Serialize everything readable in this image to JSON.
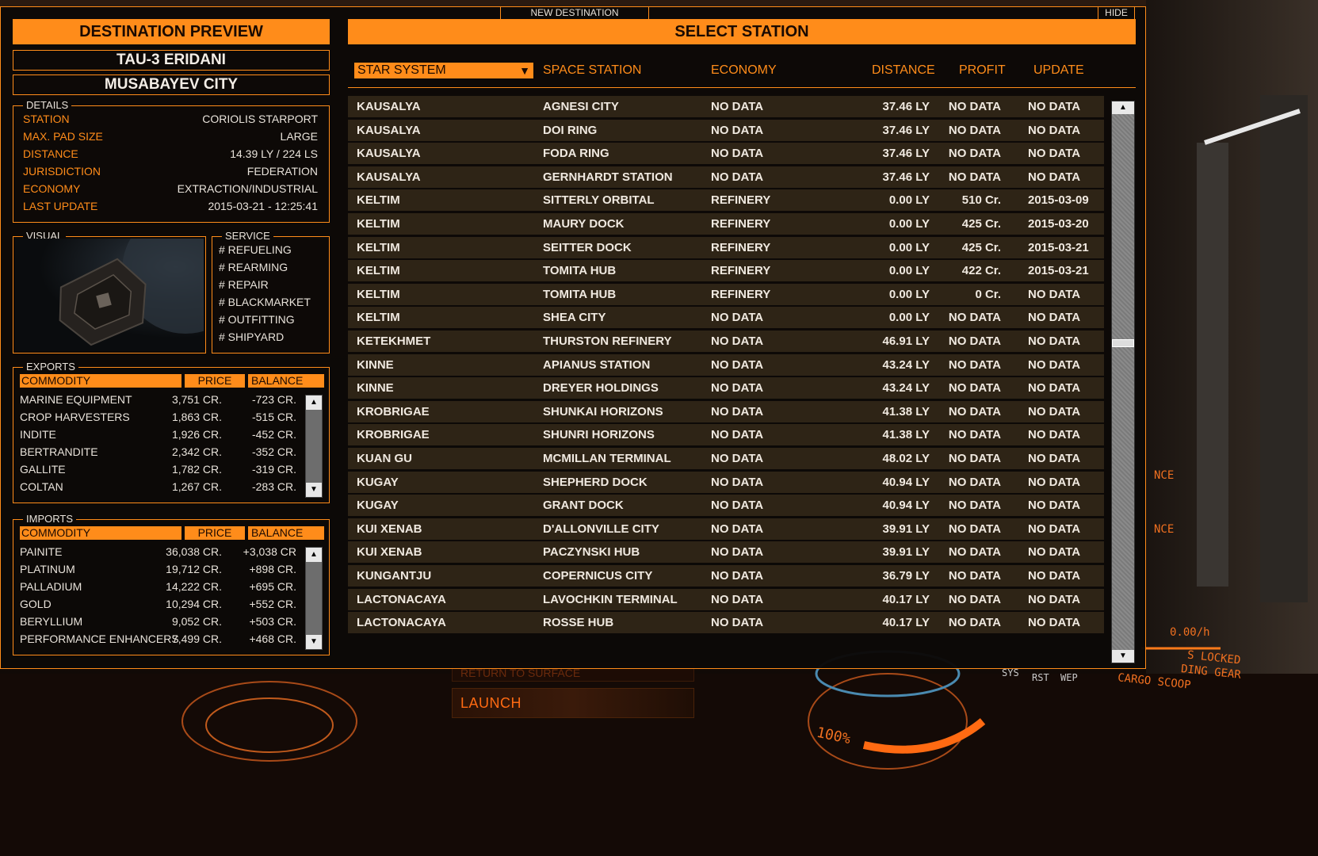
{
  "tabs": {
    "new_destination": "NEW DESTINATION",
    "hide": "HIDE"
  },
  "preview": {
    "header": "DESTINATION PREVIEW",
    "system": "TAU-3 ERIDANI",
    "station": "MUSABAYEV CITY",
    "details_label": "DETAILS",
    "details": [
      {
        "k": "STATION",
        "v": "CORIOLIS STARPORT"
      },
      {
        "k": "MAX. PAD SIZE",
        "v": "LARGE"
      },
      {
        "k": "DISTANCE",
        "v": "14.39 LY / 224 LS"
      },
      {
        "k": "JURISDICTION",
        "v": "FEDERATION"
      },
      {
        "k": "ECONOMY",
        "v": "EXTRACTION/INDUSTRIAL"
      },
      {
        "k": "LAST UPDATE",
        "v": "2015-03-21 - 12:25:41"
      }
    ],
    "visual_label": "VISUAL",
    "service_label": "SERVICE",
    "services": [
      "# REFUELING",
      "# REARMING",
      "# REPAIR",
      "# BLACKMARKET",
      "# OUTFITTING",
      "# SHIPYARD"
    ],
    "exports_label": "EXPORTS",
    "imports_label": "IMPORTS",
    "commodity_headers": {
      "commodity": "COMMODITY",
      "price": "PRICE",
      "balance": "BALANCE"
    },
    "exports": [
      {
        "n": "MARINE EQUIPMENT",
        "p": "3,751 CR.",
        "b": "-723 CR."
      },
      {
        "n": "CROP HARVESTERS",
        "p": "1,863 CR.",
        "b": "-515 CR."
      },
      {
        "n": "INDITE",
        "p": "1,926 CR.",
        "b": "-452 CR."
      },
      {
        "n": "BERTRANDITE",
        "p": "2,342 CR.",
        "b": "-352 CR."
      },
      {
        "n": "GALLITE",
        "p": "1,782 CR.",
        "b": "-319 CR."
      },
      {
        "n": "COLTAN",
        "p": "1,267 CR.",
        "b": "-283 CR."
      }
    ],
    "imports": [
      {
        "n": "PAINITE",
        "p": "36,038 CR.",
        "b": "+3,038 CR"
      },
      {
        "n": "PLATINUM",
        "p": "19,712 CR.",
        "b": "+898 CR."
      },
      {
        "n": "PALLADIUM",
        "p": "14,222 CR.",
        "b": "+695 CR."
      },
      {
        "n": "GOLD",
        "p": "10,294 CR.",
        "b": "+552 CR."
      },
      {
        "n": "BERYLLIUM",
        "p": "9,052 CR.",
        "b": "+503 CR."
      },
      {
        "n": "PERFORMANCE ENHANCERS",
        "p": "7,499 CR.",
        "b": "+468 CR."
      }
    ]
  },
  "select": {
    "header": "SELECT STATION",
    "dropdown": "STAR SYSTEM",
    "columns": {
      "station": "SPACE STATION",
      "economy": "ECONOMY",
      "distance": "DISTANCE",
      "profit": "PROFIT",
      "update": "UPDATE"
    },
    "rows": [
      {
        "sys": "KAUSALYA",
        "stn": "AGNESI CITY",
        "eco": "NO DATA",
        "dst": "37.46 LY",
        "prf": "NO DATA",
        "upd": "NO DATA"
      },
      {
        "sys": "KAUSALYA",
        "stn": "DOI RING",
        "eco": "NO DATA",
        "dst": "37.46 LY",
        "prf": "NO DATA",
        "upd": "NO DATA"
      },
      {
        "sys": "KAUSALYA",
        "stn": "FODA RING",
        "eco": "NO DATA",
        "dst": "37.46 LY",
        "prf": "NO DATA",
        "upd": "NO DATA"
      },
      {
        "sys": "KAUSALYA",
        "stn": "GERNHARDT STATION",
        "eco": "NO DATA",
        "dst": "37.46 LY",
        "prf": "NO DATA",
        "upd": "NO DATA"
      },
      {
        "sys": "KELTIM",
        "stn": "SITTERLY ORBITAL",
        "eco": "REFINERY",
        "dst": "0.00 LY",
        "prf": "510 Cr.",
        "upd": "2015-03-09"
      },
      {
        "sys": "KELTIM",
        "stn": "MAURY DOCK",
        "eco": "REFINERY",
        "dst": "0.00 LY",
        "prf": "425 Cr.",
        "upd": "2015-03-20"
      },
      {
        "sys": "KELTIM",
        "stn": "SEITTER DOCK",
        "eco": "REFINERY",
        "dst": "0.00 LY",
        "prf": "425 Cr.",
        "upd": "2015-03-21"
      },
      {
        "sys": "KELTIM",
        "stn": "TOMITA HUB",
        "eco": "REFINERY",
        "dst": "0.00 LY",
        "prf": "422 Cr.",
        "upd": "2015-03-21"
      },
      {
        "sys": "KELTIM",
        "stn": "TOMITA HUB",
        "eco": "REFINERY",
        "dst": "0.00 LY",
        "prf": "0 Cr.",
        "upd": "NO DATA"
      },
      {
        "sys": "KELTIM",
        "stn": "SHEA CITY",
        "eco": "NO DATA",
        "dst": "0.00 LY",
        "prf": "NO DATA",
        "upd": "NO DATA"
      },
      {
        "sys": "KETEKHMET",
        "stn": "THURSTON REFINERY",
        "eco": "NO DATA",
        "dst": "46.91 LY",
        "prf": "NO DATA",
        "upd": "NO DATA"
      },
      {
        "sys": "KINNE",
        "stn": "APIANUS STATION",
        "eco": "NO DATA",
        "dst": "43.24 LY",
        "prf": "NO DATA",
        "upd": "NO DATA"
      },
      {
        "sys": "KINNE",
        "stn": "DREYER HOLDINGS",
        "eco": "NO DATA",
        "dst": "43.24 LY",
        "prf": "NO DATA",
        "upd": "NO DATA"
      },
      {
        "sys": "KROBRIGAE",
        "stn": "SHUNKAI HORIZONS",
        "eco": "NO DATA",
        "dst": "41.38 LY",
        "prf": "NO DATA",
        "upd": "NO DATA"
      },
      {
        "sys": "KROBRIGAE",
        "stn": "SHUNRI HORIZONS",
        "eco": "NO DATA",
        "dst": "41.38 LY",
        "prf": "NO DATA",
        "upd": "NO DATA"
      },
      {
        "sys": "KUAN GU",
        "stn": "MCMILLAN TERMINAL",
        "eco": "NO DATA",
        "dst": "48.02 LY",
        "prf": "NO DATA",
        "upd": "NO DATA"
      },
      {
        "sys": "KUGAY",
        "stn": "SHEPHERD DOCK",
        "eco": "NO DATA",
        "dst": "40.94 LY",
        "prf": "NO DATA",
        "upd": "NO DATA"
      },
      {
        "sys": "KUGAY",
        "stn": "GRANT DOCK",
        "eco": "NO DATA",
        "dst": "40.94 LY",
        "prf": "NO DATA",
        "upd": "NO DATA"
      },
      {
        "sys": "KUI XENAB",
        "stn": "D'ALLONVILLE CITY",
        "eco": "NO DATA",
        "dst": "39.91 LY",
        "prf": "NO DATA",
        "upd": "NO DATA"
      },
      {
        "sys": "KUI XENAB",
        "stn": "PACZYNSKI HUB",
        "eco": "NO DATA",
        "dst": "39.91 LY",
        "prf": "NO DATA",
        "upd": "NO DATA"
      },
      {
        "sys": "KUNGANTJU",
        "stn": "COPERNICUS CITY",
        "eco": "NO DATA",
        "dst": "36.79 LY",
        "prf": "NO DATA",
        "upd": "NO DATA"
      },
      {
        "sys": "LACTONACAYA",
        "stn": "LAVOCHKIN TERMINAL",
        "eco": "NO DATA",
        "dst": "40.17 LY",
        "prf": "NO DATA",
        "upd": "NO DATA"
      },
      {
        "sys": "LACTONACAYA",
        "stn": "ROSSE HUB",
        "eco": "NO DATA",
        "dst": "40.17 LY",
        "prf": "NO DATA",
        "upd": "NO DATA"
      }
    ]
  },
  "cockpit": {
    "launch": "LAUNCH",
    "return": "RETURN TO SURFACE",
    "speed": "0.00/h",
    "throttle": "100%",
    "status1": "S LOCKED",
    "status2": "DING GEAR",
    "status3": "CARGO SCOOP",
    "rst": "RST",
    "wep": "WEP",
    "sys": "SYS",
    "tag1": "NCE",
    "tag2": "NCE"
  },
  "colors": {
    "accent": "#ff8c1a",
    "panel_bg": "#0c0907",
    "row_bg": "#2e2416"
  }
}
